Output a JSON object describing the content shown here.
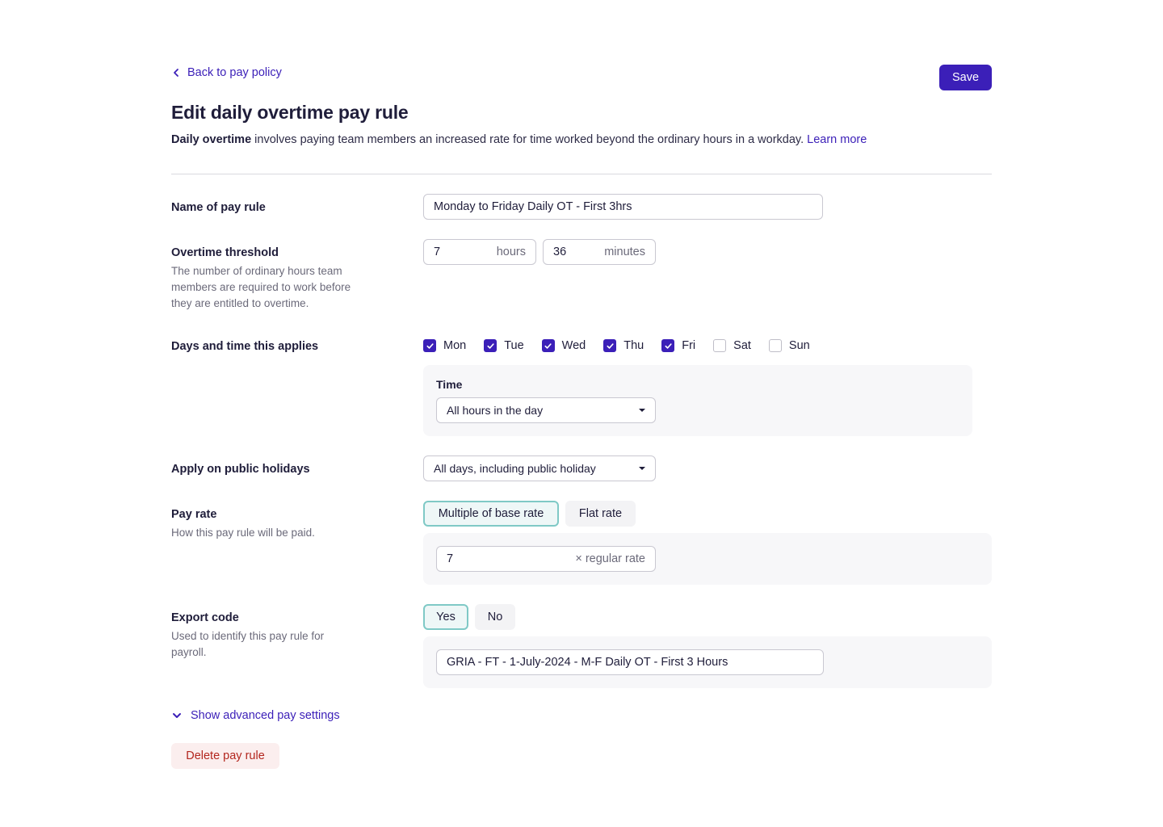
{
  "header": {
    "back_label": "Back to pay policy",
    "save_label": "Save",
    "title": "Edit daily overtime pay rule",
    "intro_bold": "Daily overtime",
    "intro_text": " involves paying team members an increased rate for time worked beyond the ordinary hours in a workday. ",
    "learn_more": "Learn more"
  },
  "name_field": {
    "label": "Name of pay rule",
    "value": "Monday to Friday Daily OT - First 3hrs"
  },
  "threshold": {
    "label": "Overtime threshold",
    "help": "The number of ordinary hours team members are required to work before they are entitled to overtime.",
    "hours_value": "7",
    "hours_suffix": "hours",
    "minutes_value": "36",
    "minutes_suffix": "minutes"
  },
  "days": {
    "label": "Days and time this applies",
    "items": [
      {
        "label": "Mon",
        "checked": true
      },
      {
        "label": "Tue",
        "checked": true
      },
      {
        "label": "Wed",
        "checked": true
      },
      {
        "label": "Thu",
        "checked": true
      },
      {
        "label": "Fri",
        "checked": true
      },
      {
        "label": "Sat",
        "checked": false
      },
      {
        "label": "Sun",
        "checked": false
      }
    ],
    "time_label": "Time",
    "time_value": "All hours in the day"
  },
  "holidays": {
    "label": "Apply on public holidays",
    "value": "All days, including public holiday"
  },
  "pay_rate": {
    "label": "Pay rate",
    "help": "How this pay rule will be paid.",
    "options": [
      "Multiple of base rate",
      "Flat rate"
    ],
    "selected": "Multiple of base rate",
    "multiplier_value": "7",
    "multiplier_suffix": "× regular rate"
  },
  "export_code": {
    "label": "Export code",
    "help": "Used to identify this pay rule for payroll.",
    "options": [
      "Yes",
      "No"
    ],
    "selected": "Yes",
    "value": "GRIA - FT - 1-July-2024 - M-F Daily OT - First 3 Hours"
  },
  "footer": {
    "advanced_label": "Show advanced pay settings",
    "delete_label": "Delete pay rule"
  },
  "colors": {
    "primary": "#3b1fb8",
    "checkbox": "#3b1fb8",
    "segment_active_border": "#7fc9c6",
    "danger_text": "#b3261e",
    "danger_bg": "#fbeeee"
  },
  "icons": {
    "back": "chevron-left-icon",
    "advanced": "chevron-down-icon",
    "select": "caret-down-icon",
    "checkbox": "check-icon"
  }
}
